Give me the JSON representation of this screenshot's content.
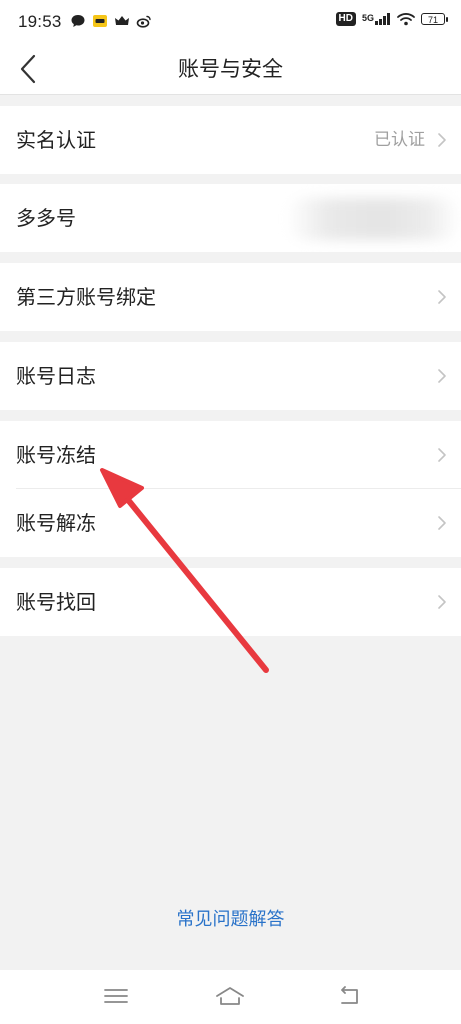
{
  "status_bar": {
    "time": "19:53",
    "hd_badge": "HD",
    "network": "5G",
    "battery": "71"
  },
  "header": {
    "title": "账号与安全"
  },
  "settings": {
    "real_name": {
      "label": "实名认证",
      "value": "已认证"
    },
    "duoduo_id": {
      "label": "多多号"
    },
    "third_party": {
      "label": "第三方账号绑定"
    },
    "account_log": {
      "label": "账号日志"
    },
    "account_freeze": {
      "label": "账号冻结"
    },
    "account_unfreeze": {
      "label": "账号解冻"
    },
    "account_recover": {
      "label": "账号找回"
    }
  },
  "footer": {
    "faq_label": "常见问题解答"
  },
  "colors": {
    "link": "#2a73c9",
    "annotation_arrow": "#e8393f",
    "background": "#f2f2f2"
  }
}
